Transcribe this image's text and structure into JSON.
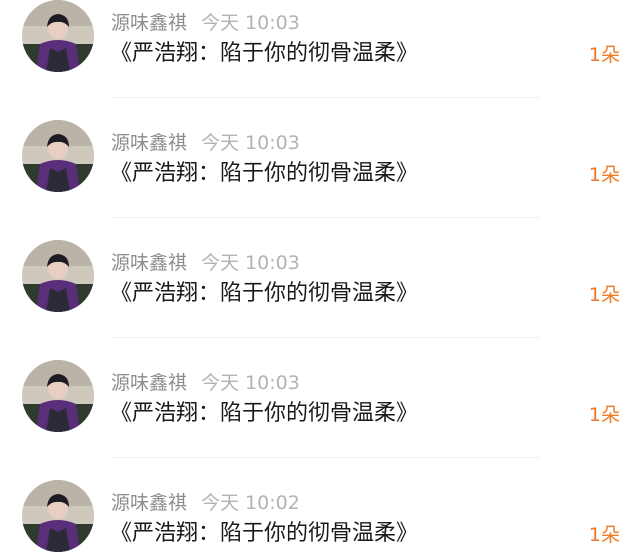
{
  "gifts": [
    {
      "username": "源味鑫祺",
      "time": "今天 10:03",
      "title": "《严浩翔：陷于你的彻骨温柔》",
      "count": "1朵",
      "avatar_icon": "user-avatar"
    },
    {
      "username": "源味鑫祺",
      "time": "今天 10:03",
      "title": "《严浩翔：陷于你的彻骨温柔》",
      "count": "1朵",
      "avatar_icon": "user-avatar"
    },
    {
      "username": "源味鑫祺",
      "time": "今天 10:03",
      "title": "《严浩翔：陷于你的彻骨温柔》",
      "count": "1朵",
      "avatar_icon": "user-avatar"
    },
    {
      "username": "源味鑫祺",
      "time": "今天 10:03",
      "title": "《严浩翔：陷于你的彻骨温柔》",
      "count": "1朵",
      "avatar_icon": "user-avatar"
    },
    {
      "username": "源味鑫祺",
      "time": "今天 10:02",
      "title": "《严浩翔：陷于你的彻骨温柔》",
      "count": "1朵",
      "avatar_icon": "user-avatar"
    }
  ],
  "colors": {
    "count": "#f27a24",
    "username": "#8c8c8c",
    "time": "#b3b3b3",
    "title": "#1a1a1a",
    "divider": "#f0f0f0"
  }
}
